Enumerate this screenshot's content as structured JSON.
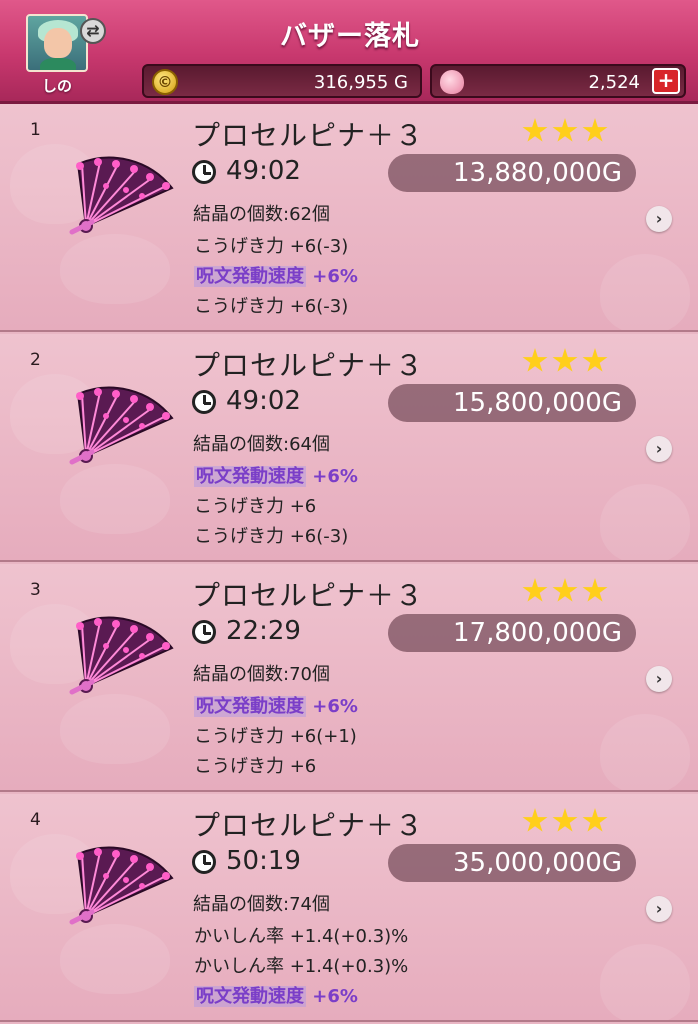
{
  "header": {
    "title": "バザー落札",
    "avatar_name": "しの",
    "gold": "316,955 G",
    "gems": "2,524",
    "plus_label": "+",
    "coin_glyph": "©"
  },
  "items": [
    {
      "index": "1",
      "name": "プロセルピナ＋３",
      "stars": 3,
      "time": "49:02",
      "price": "13,880,000G",
      "crystals": "結晶の個数:62個",
      "stats": [
        {
          "text": "こうげき力 +6(-3)",
          "highlight": false
        },
        {
          "text": "呪文発動速度 +6%",
          "highlight": true
        },
        {
          "text": "こうげき力 +6(-3)",
          "highlight": false
        }
      ]
    },
    {
      "index": "2",
      "name": "プロセルピナ＋３",
      "stars": 3,
      "time": "49:02",
      "price": "15,800,000G",
      "crystals": "結晶の個数:64個",
      "stats": [
        {
          "text": "呪文発動速度 +6%",
          "highlight": true
        },
        {
          "text": "こうげき力 +6",
          "highlight": false
        },
        {
          "text": "こうげき力 +6(-3)",
          "highlight": false
        }
      ]
    },
    {
      "index": "3",
      "name": "プロセルピナ＋３",
      "stars": 3,
      "time": "22:29",
      "price": "17,800,000G",
      "crystals": "結晶の個数:70個",
      "stats": [
        {
          "text": "呪文発動速度 +6%",
          "highlight": true
        },
        {
          "text": "こうげき力 +6(+1)",
          "highlight": false
        },
        {
          "text": "こうげき力 +6",
          "highlight": false
        }
      ]
    },
    {
      "index": "4",
      "name": "プロセルピナ＋３",
      "stars": 3,
      "time": "50:19",
      "price": "35,000,000G",
      "crystals": "結晶の個数:74個",
      "stats": [
        {
          "text": "かいしん率 +1.4(+0.3)%",
          "highlight": false
        },
        {
          "text": "かいしん率 +1.4(+0.3)%",
          "highlight": false
        },
        {
          "text": "呪文発動速度 +6%",
          "highlight": true
        }
      ]
    }
  ],
  "icons": {
    "clock": "clock-icon",
    "star": "star-icon",
    "fan": "fan-icon",
    "arrow": "chevron-right-icon",
    "coin": "coin-icon",
    "gem": "gem-icon",
    "swap": "swap-icon"
  },
  "colors": {
    "header": "#c8386e",
    "row": "#efc3cf",
    "stat_highlight": "#7a3ec8",
    "star": "#ffcf1a"
  }
}
